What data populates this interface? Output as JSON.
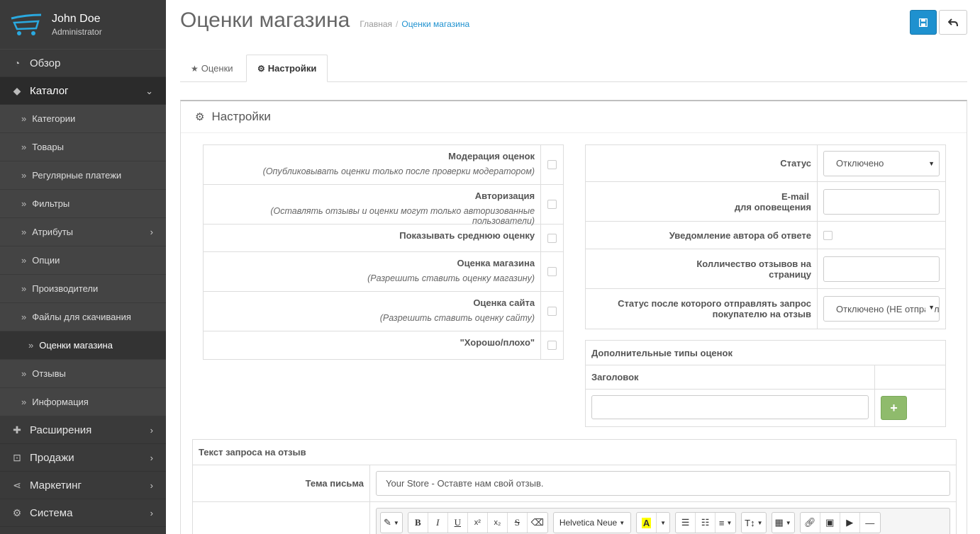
{
  "user": {
    "name": "John Doe",
    "role": "Administrator"
  },
  "nav": {
    "overview": "Обзор",
    "catalog": "Каталог",
    "sub": {
      "categories": "Категории",
      "products": "Товары",
      "recurring": "Регулярные платежи",
      "filters": "Фильтры",
      "attributes": "Атрибуты",
      "options": "Опции",
      "manufacturers": "Производители",
      "downloads": "Файлы для скачивания",
      "store_ratings": "Оценки магазина",
      "reviews": "Отзывы",
      "information": "Информация"
    },
    "extensions": "Расширения",
    "sales": "Продажи",
    "marketing": "Маркетинг",
    "system": "Система"
  },
  "header": {
    "title": "Оценки магазина",
    "breadcrumb_home": "Главная",
    "breadcrumb_current": "Оценки магазина"
  },
  "tabs": {
    "ratings": "Оценки",
    "settings": "Настройки"
  },
  "panel": {
    "title": "Настройки"
  },
  "left_settings": {
    "moderation": {
      "label": "Модерация оценок",
      "help": "(Опубликовывать оценки только после проверки модератором)"
    },
    "authorization": {
      "label": "Авторизация",
      "help": "(Оставлять отзывы и оценки могут только авторизованные пользователи)"
    },
    "average": {
      "label": "Показывать среднюю оценку"
    },
    "store_rating": {
      "label": "Оценка магазина",
      "help": "(Разрешить ставить оценку магазину)"
    },
    "site_rating": {
      "label": "Оценка сайта",
      "help": "(Разрешить ставить оценку сайту)"
    },
    "good_bad": {
      "label": "\"Хорошо/плохо\""
    }
  },
  "right_settings": {
    "status": {
      "label": "Статус",
      "value": "Отключено"
    },
    "email": {
      "label_line1": "E-mail",
      "label_line2": "для оповещения",
      "value": ""
    },
    "notify_author": {
      "label": "Уведомление автора об ответе"
    },
    "per_page": {
      "label": "Колличество отзывов на страницу",
      "value": ""
    },
    "request_status": {
      "label": "Статус после которого отправлять запрос покупателю на отзыв",
      "value": "Отключено (НЕ отправлять)"
    }
  },
  "extra_types": {
    "title": "Дополнительные типы оценок",
    "col_header": "Заголовок",
    "input_value": "",
    "add_label": "+"
  },
  "request": {
    "title": "Текст запроса на отзыв",
    "subject_label": "Тема письма",
    "subject_value": "Your Store - Оставте нам свой отзыв."
  },
  "editor": {
    "font_name": "Helvetica Neue"
  }
}
